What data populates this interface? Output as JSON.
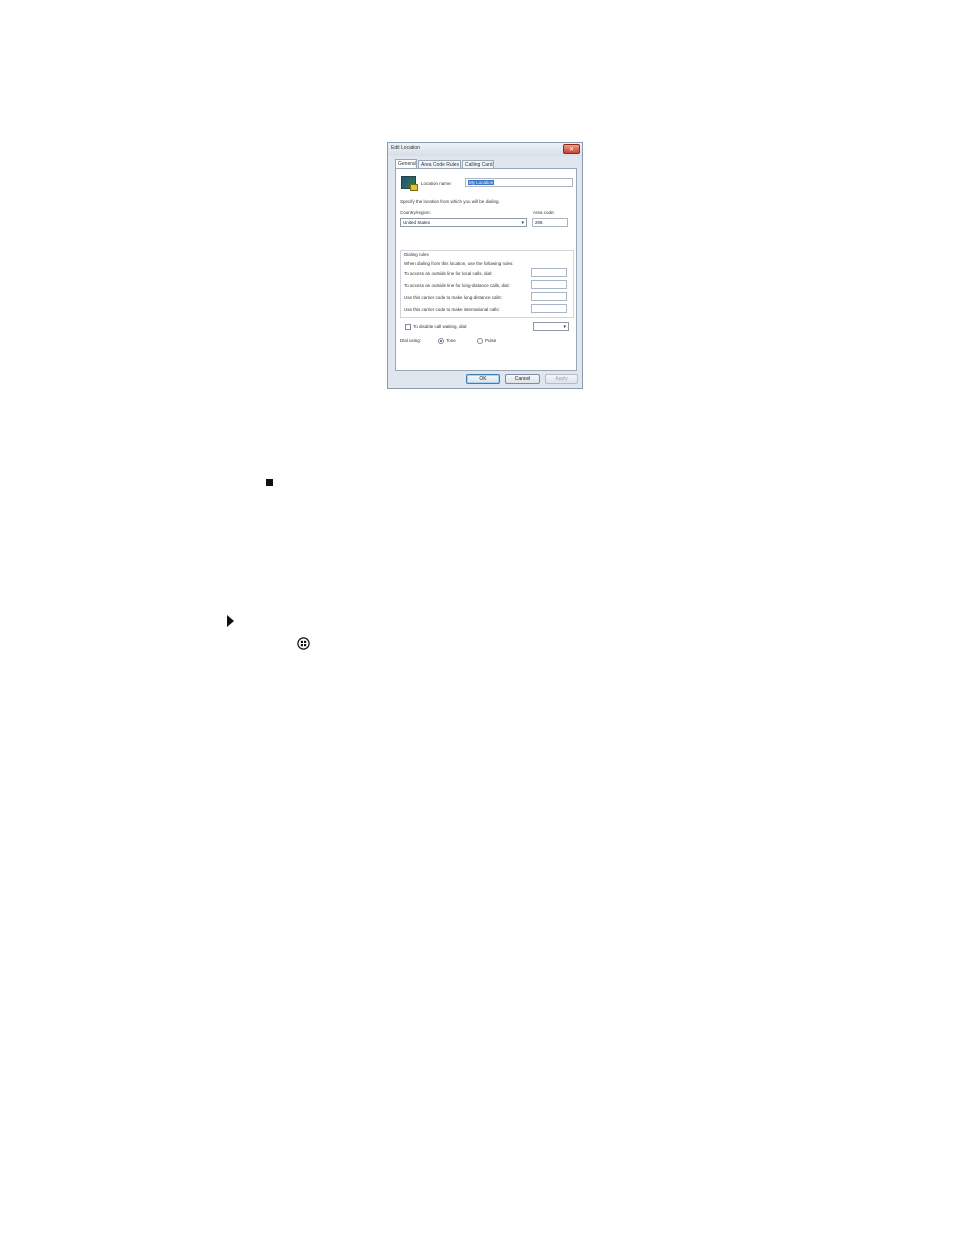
{
  "dialog": {
    "title": "Edit Location",
    "close_label": "✕",
    "tabs": [
      {
        "label": "General"
      },
      {
        "label": "Area Code Rules"
      },
      {
        "label": "Calling Card"
      }
    ],
    "location_name_label": "Location name:",
    "location_name_value": "My Location",
    "specify_text": "Specify the location from which you will be dialing.",
    "country_label": "Country/region:",
    "country_value": "United States",
    "area_code_label": "Area code:",
    "area_code_value": "206",
    "dialing_rules": {
      "heading": "Dialing rules",
      "intro": "When dialing from this location, use the following rules:",
      "local_line": "To access an outside line for local calls, dial:",
      "long_distance_line": "To access an outside line for long-distance calls, dial:",
      "carrier_long_distance": "Use this carrier code to make long-distance calls:",
      "carrier_international": "Use this carrier code to make international calls:"
    },
    "call_waiting_label": "To disable call waiting, dial:",
    "dial_using_label": "Dial using:",
    "tone_label": "Tone",
    "pulse_label": "Pulse",
    "buttons": {
      "ok": "OK",
      "cancel": "Cancel",
      "apply": "Apply"
    }
  },
  "page": {
    "icons": [
      "square-bullet-icon",
      "play-arrow-icon",
      "windows-start-icon"
    ]
  }
}
